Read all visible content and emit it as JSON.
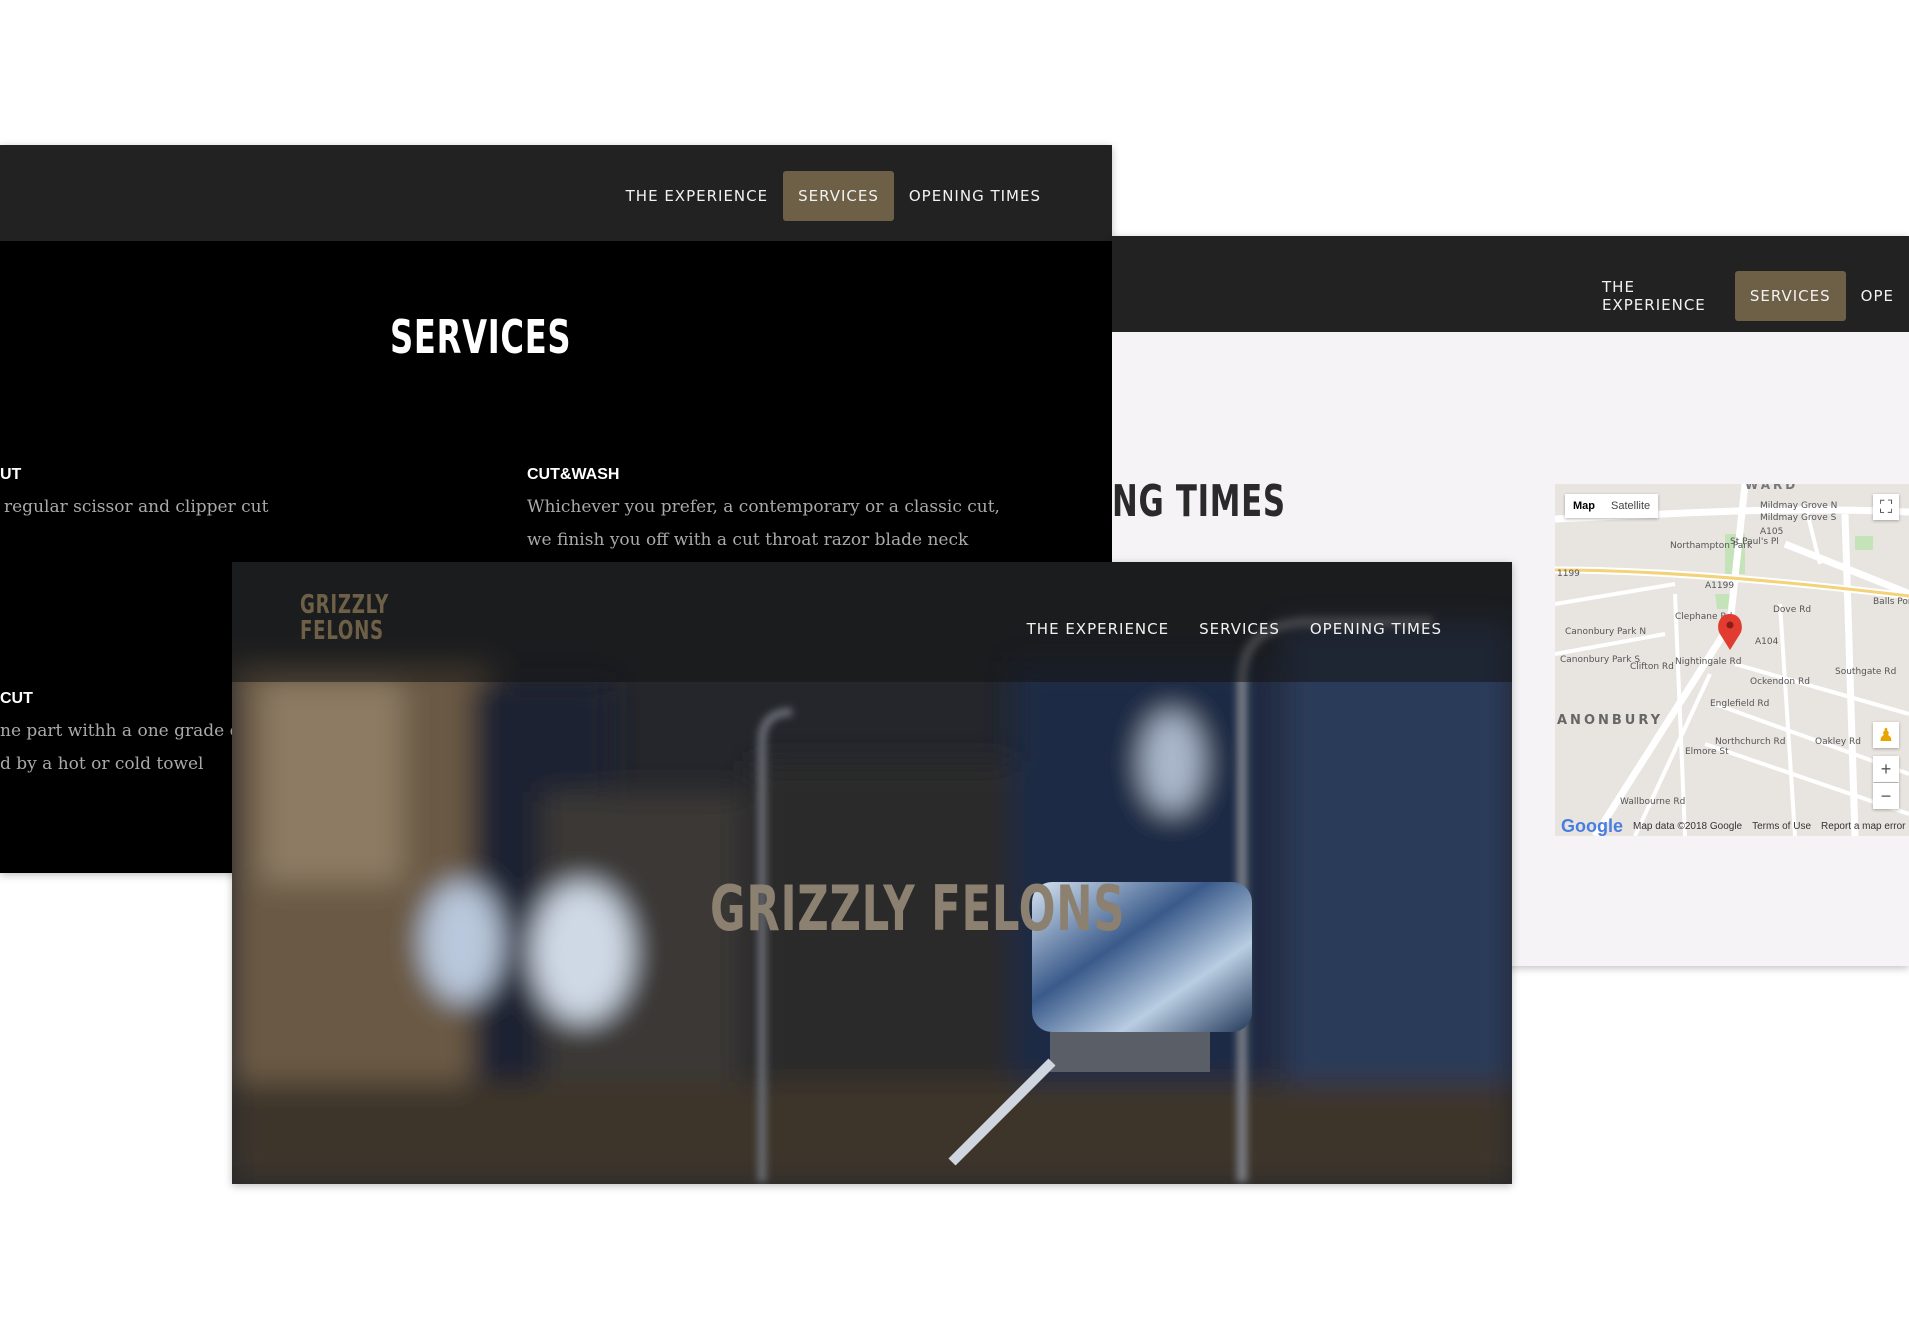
{
  "services_page": {
    "nav": [
      "THE EXPERIENCE",
      "SERVICES",
      "OPENING TIMES"
    ],
    "title": "SERVICES",
    "items": [
      {
        "name": "UT",
        "lines": [
          "regular scissor and clipper cut"
        ]
      },
      {
        "name": "CUT&WASH",
        "lines": [
          "Whichever you prefer, a contemporary or a classic cut,",
          "we finish you off with a cut throat razor blade neck"
        ]
      },
      {
        "name": "CUT",
        "lines": [
          "ne part withh a one grade clip",
          "d by a hot or cold towel"
        ]
      }
    ]
  },
  "times_page": {
    "nav": [
      "THE EXPERIENCE",
      "SERVICES",
      "OPE"
    ],
    "title": "NG TIMES",
    "map": {
      "type_buttons": [
        "Map",
        "Satellite"
      ],
      "labels": [
        "WARD",
        "Mildmay Grove N",
        "Mildmay Grove S",
        "Northampton Park",
        "A1199",
        "1199",
        "Dove Rd",
        "Balls Pon",
        "Canonbury Park N",
        "Canonbury Park S",
        "A104",
        "Southgate Rd",
        "Ockendon Rd",
        "Englefield Rd",
        "ANONBURY",
        "Northchurch Rd",
        "Oakley Rd",
        "Elmore St",
        "Clephane Rd",
        "Nightingale Rd",
        "Clifton Rd",
        "Wallbourne Rd",
        "St Paul's Pl",
        "A105"
      ],
      "attribution": "Map data ©2018 Google",
      "terms": "Terms of Use",
      "report": "Report a map error",
      "google": "Google",
      "zoom_in": "+",
      "zoom_out": "−"
    }
  },
  "hero_page": {
    "logo": [
      "GRIZZLY",
      "FELONS"
    ],
    "nav": [
      "THE EXPERIENCE",
      "SERVICES",
      "OPENING TIMES"
    ],
    "title": "GRIZZLY FELONS"
  },
  "colors": {
    "accent": "#6e6047",
    "bar": "#222222"
  }
}
